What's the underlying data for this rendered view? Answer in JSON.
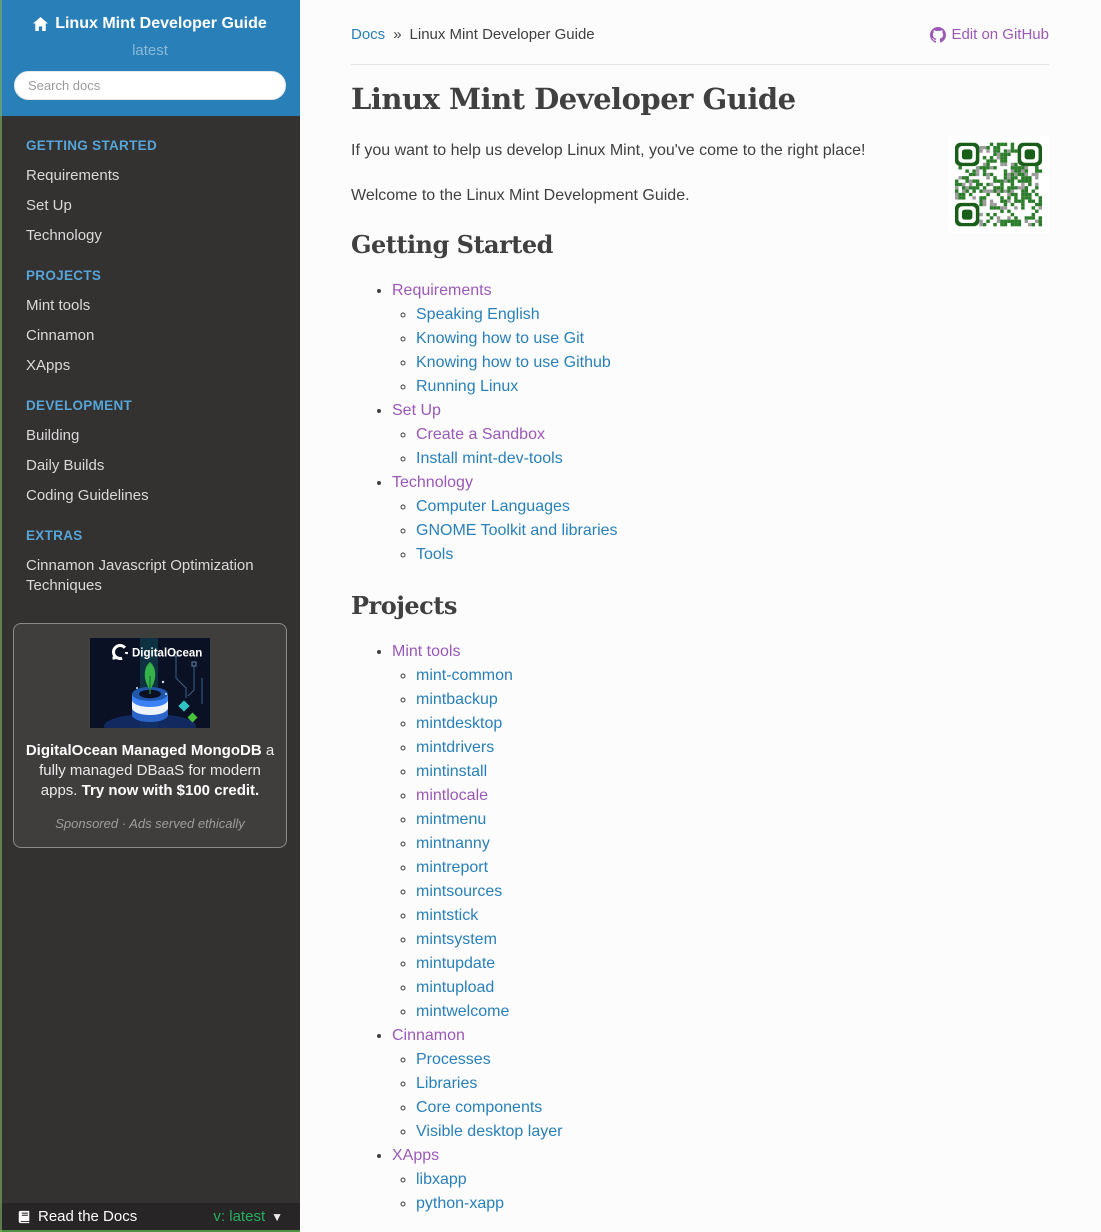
{
  "colors": {
    "header_blue": "#2980b9",
    "sidebar_bg": "#343131",
    "caption_blue": "#55a5d9",
    "link_blue": "#2980b9",
    "link_visited_purple": "#9b59b6",
    "version_green": "#27ae60",
    "text": "#404040",
    "content_bg": "#fcfcfc"
  },
  "sidebar": {
    "title": "Linux Mint Developer Guide",
    "version": "latest",
    "search_placeholder": "Search docs",
    "sections": [
      {
        "caption": "GETTING STARTED",
        "items": [
          "Requirements",
          "Set Up",
          "Technology"
        ]
      },
      {
        "caption": "PROJECTS",
        "items": [
          "Mint tools",
          "Cinnamon",
          "XApps"
        ]
      },
      {
        "caption": "DEVELOPMENT",
        "items": [
          "Building",
          "Daily Builds",
          "Coding Guidelines"
        ]
      },
      {
        "caption": "EXTRAS",
        "items": [
          "Cinnamon Javascript Optimization Techniques"
        ]
      }
    ],
    "ad": {
      "brand": "DigitalOcean",
      "title": "DigitalOcean Managed MongoDB",
      "body": " a fully managed DBaaS for modern apps. ",
      "cta": "Try now with $100 credit.",
      "disclosure": "Sponsored · Ads served ethically"
    },
    "footer": {
      "label": "Read the Docs",
      "version_label": "v: latest"
    }
  },
  "main": {
    "breadcrumb": {
      "docs": "Docs",
      "separator": "»",
      "current": "Linux Mint Developer Guide"
    },
    "edit_link": "Edit on GitHub",
    "page_title": "Linux Mint Developer Guide",
    "intro": [
      "If you want to help us develop Linux Mint, you've come to the right place!",
      "Welcome to the Linux Mint Development Guide."
    ],
    "sections": [
      {
        "heading": "Getting Started",
        "items": [
          {
            "label": "Requirements",
            "visited": true,
            "children": [
              {
                "label": "Speaking English"
              },
              {
                "label": "Knowing how to use Git"
              },
              {
                "label": "Knowing how to use Github"
              },
              {
                "label": "Running Linux"
              }
            ]
          },
          {
            "label": "Set Up",
            "visited": true,
            "children": [
              {
                "label": "Create a Sandbox",
                "visited": true
              },
              {
                "label": "Install mint-dev-tools"
              }
            ]
          },
          {
            "label": "Technology",
            "visited": true,
            "children": [
              {
                "label": "Computer Languages"
              },
              {
                "label": "GNOME Toolkit and libraries"
              },
              {
                "label": "Tools"
              }
            ]
          }
        ]
      },
      {
        "heading": "Projects",
        "items": [
          {
            "label": "Mint tools",
            "visited": true,
            "children": [
              {
                "label": "mint-common"
              },
              {
                "label": "mintbackup"
              },
              {
                "label": "mintdesktop"
              },
              {
                "label": "mintdrivers"
              },
              {
                "label": "mintinstall"
              },
              {
                "label": "mintlocale",
                "visited": true
              },
              {
                "label": "mintmenu"
              },
              {
                "label": "mintnanny"
              },
              {
                "label": "mintreport"
              },
              {
                "label": "mintsources"
              },
              {
                "label": "mintstick"
              },
              {
                "label": "mintsystem"
              },
              {
                "label": "mintupdate"
              },
              {
                "label": "mintupload"
              },
              {
                "label": "mintwelcome"
              }
            ]
          },
          {
            "label": "Cinnamon",
            "visited": true,
            "children": [
              {
                "label": "Processes"
              },
              {
                "label": "Libraries"
              },
              {
                "label": "Core components"
              },
              {
                "label": "Visible desktop layer"
              }
            ]
          },
          {
            "label": "XApps",
            "visited": true,
            "children": [
              {
                "label": "libxapp"
              },
              {
                "label": "python-xapp"
              }
            ]
          }
        ]
      }
    ]
  }
}
